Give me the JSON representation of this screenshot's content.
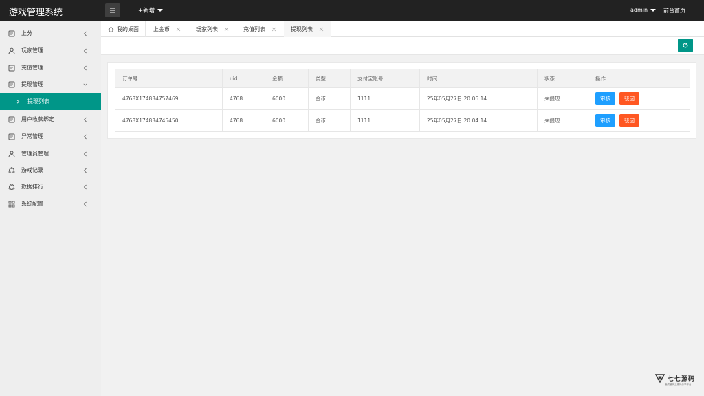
{
  "app": {
    "title": "游戏管理系统"
  },
  "header": {
    "add_new": "+新增",
    "admin": "admin",
    "frontpage": "前台首页"
  },
  "sidebar": {
    "items": [
      {
        "label": "上分",
        "icon": "document-icon"
      },
      {
        "label": "玩家管理",
        "icon": "user-icon"
      },
      {
        "label": "充值管理",
        "icon": "document-icon"
      },
      {
        "label": "提现管理",
        "icon": "document-icon"
      },
      {
        "label": "提现列表"
      },
      {
        "label": "用户收款绑定",
        "icon": "document-icon"
      },
      {
        "label": "异常管理",
        "icon": "document-icon"
      },
      {
        "label": "管理员管理",
        "icon": "users-icon"
      },
      {
        "label": "游戏记录",
        "icon": "cycle-icon"
      },
      {
        "label": "数据排行",
        "icon": "cycle-icon"
      },
      {
        "label": "系统配置",
        "icon": "grid-icon"
      }
    ]
  },
  "tabs": [
    {
      "label": "我的桌面"
    },
    {
      "label": "上金币"
    },
    {
      "label": "玩家列表"
    },
    {
      "label": "充值列表"
    },
    {
      "label": "提现列表"
    }
  ],
  "table": {
    "headers": [
      "订单号",
      "uid",
      "金额",
      "类型",
      "支付宝账号",
      "时间",
      "状态",
      "操作"
    ],
    "rows": [
      {
        "order": "4768X174834757469",
        "uid": "4768",
        "amount": "6000",
        "type": "金币",
        "alipay": "1111",
        "time": "25年05月27日 20:06:14",
        "status": "未提现"
      },
      {
        "order": "4768X174834745450",
        "uid": "4768",
        "amount": "6000",
        "type": "金币",
        "alipay": "1111",
        "time": "25年05月27日 20:04:14",
        "status": "未提现"
      }
    ],
    "audit_label": "审核",
    "reject_label": "驳回"
  },
  "colors": {
    "accent": "#009688",
    "header_bg": "#222222",
    "audit": "#1e9fff",
    "reject": "#ff5722"
  },
  "watermark": {
    "text": "七七源码",
    "subtext": "高质量商业源码分享平台"
  }
}
